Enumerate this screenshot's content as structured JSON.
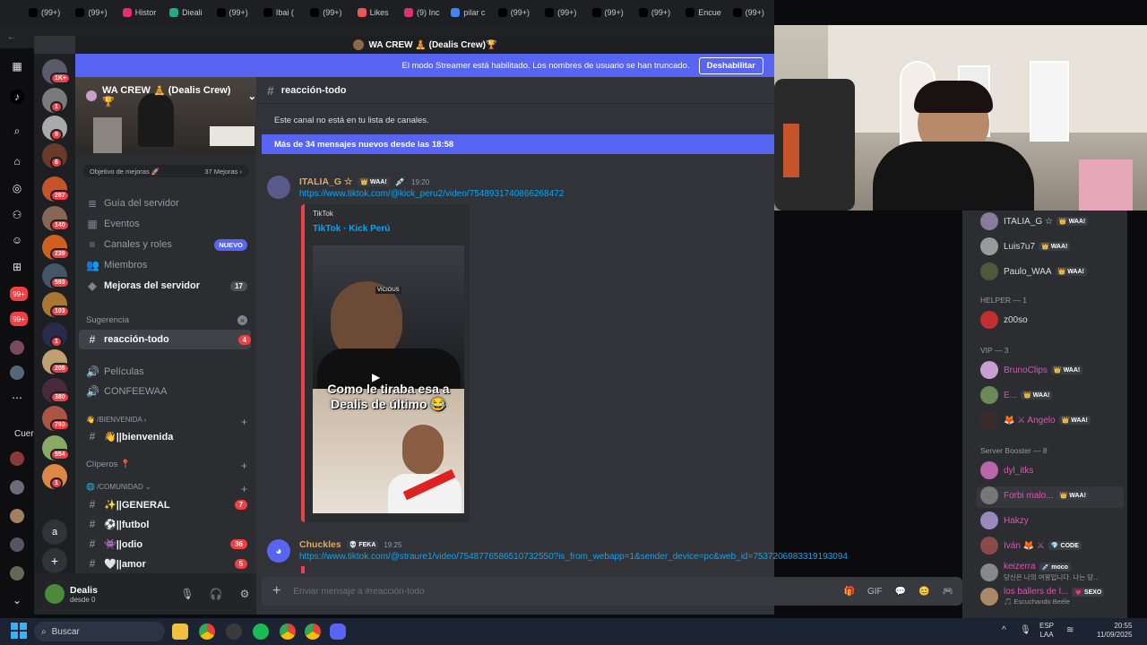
{
  "browser": {
    "tabs": [
      "(99+)",
      "(99+)",
      "Histor",
      "Dieali",
      "(99+)",
      "Ibai (",
      "(99+)",
      "Likes",
      "(9) Inc",
      "pilar c",
      "(99+)",
      "(99+)",
      "(99+)",
      "(99+)",
      "Encue",
      "(99+)"
    ]
  },
  "window": {
    "title": "WA CREW 🧘 (Dealis Crew)🏆"
  },
  "streamer": {
    "text": "El modo Streamer está habilitado. Los nombres de usuario se han truncado.",
    "button": "Deshabilitar"
  },
  "guilds": {
    "badges": [
      "1K+",
      "1",
      "8",
      "6",
      "287",
      "140",
      "239",
      "593",
      "103",
      "1",
      "205",
      "380",
      "793",
      "554",
      "1"
    ],
    "letter": "a",
    "add": "+"
  },
  "server": {
    "name": "WA CREW 🧘 (Dealis Crew)🏆",
    "boost_goal": "Objetivo de mejoras 🚀",
    "boost_count": "37 Mejoras ›",
    "nav": [
      {
        "label": "Guía del servidor",
        "icon": "≣"
      },
      {
        "label": "Eventos",
        "icon": "▦"
      },
      {
        "label": "Canales y roles",
        "icon": "≡",
        "badge": "NUEVO"
      },
      {
        "label": "Miembros",
        "icon": "👥"
      },
      {
        "label": "Mejoras del servidor",
        "icon": "◆",
        "count": "17"
      }
    ],
    "suggestion_label": "Sugerencia",
    "active_channel": "reacción-todo",
    "active_count": "4",
    "voice": [
      {
        "label": "Películas"
      },
      {
        "label": "CONFEEWAA"
      }
    ],
    "cat_welcome": "👋 /bienvenida ›",
    "ch_welcome": "👋||bienvenida",
    "cat_clips": "Clíperos 📍",
    "cat_community": "🌐 /comunidad ⌄",
    "community": [
      {
        "label": "✨||GENERAL",
        "count": "7"
      },
      {
        "label": "⚽||futbol",
        "count": ""
      },
      {
        "label": "👾||odio",
        "count": "36"
      },
      {
        "label": "🤍||amor",
        "count": "5"
      }
    ]
  },
  "user": {
    "name": "Dealis",
    "status": "desde 0",
    "icons": [
      "🎙",
      "🎧",
      "⚙"
    ]
  },
  "channel": {
    "name": "reacción-todo",
    "not_in_list": "Este canal no está en tu lista de canales.",
    "new_messages": "Más de 34 mensajes nuevos desde las 18:58",
    "composer_placeholder": "Enviar mensaje a #reacción-todo",
    "composer_icons": [
      "🎁",
      "GIF",
      "💬",
      "😊",
      "🎮"
    ]
  },
  "messages": [
    {
      "author": "ITALIA_G ☆",
      "tag": "👑 WAA!",
      "extra": "💉",
      "time": "19:20",
      "link": "https://www.tiktok.com/@kick_peru2/video/7548931740866268472",
      "embed": {
        "provider": "TikTok",
        "title": "TikTok · Kick Perú",
        "caption": "Como le tiraba esa a Dealis de último 😂",
        "overlay_text": "VICIOUS"
      }
    },
    {
      "author": "Chuckles",
      "tag": "💀 FEKA",
      "time": "19:25",
      "link": "https://www.tiktok.com/@straure1/video/7548776586510732550?is_from_webapp=1&sender_device=pc&web_id=7537206983319193094"
    }
  ],
  "members": {
    "top": [
      {
        "name": "ITALIA_G ☆",
        "tag": "👑 WAA!"
      },
      {
        "name": "Luis7u7",
        "tag": "👑 WAA!"
      },
      {
        "name": "Paulo_WAA",
        "tag": "👑 WAA!"
      }
    ],
    "helper_header": "HELPER — 1",
    "helper": [
      {
        "name": "z00so"
      }
    ],
    "vip_header": "VIP — 3",
    "vip": [
      {
        "name": "BrunoClips",
        "tag": "👑 WAA!"
      },
      {
        "name": "E...",
        "tag": "👑 WAA!"
      },
      {
        "name": "🦊 ⚔ Angelo",
        "tag": "👑 WAA!"
      }
    ],
    "booster_header": "Server Booster — 8",
    "boosters": [
      {
        "name": "dyl_itks",
        "tag": ""
      },
      {
        "name": "Forbi malo...",
        "tag": "👑 WAA!"
      },
      {
        "name": "Hakzy",
        "tag": ""
      },
      {
        "name": "Iván 🦊 ⚔",
        "tag": "💎 CODE"
      },
      {
        "name": "keizerra",
        "tag": "💉 moco",
        "sub": "당신은 나의 여왕입니다. 나는 당..."
      },
      {
        "name": "los ballers de l...",
        "tag": "💗 SEXO",
        "sub": "🎵 Escuchando Beéle"
      }
    ]
  },
  "taskbar": {
    "search": "Buscar",
    "lang": "ESP",
    "lang2": "LAA",
    "time": "20:55",
    "date": "11/09/2025",
    "sidebar_label": "Cuer"
  },
  "colors": {
    "blurple": "#5865f2",
    "danger": "#f23f43",
    "link": "#00a8fc",
    "pink": "#e252b5"
  }
}
